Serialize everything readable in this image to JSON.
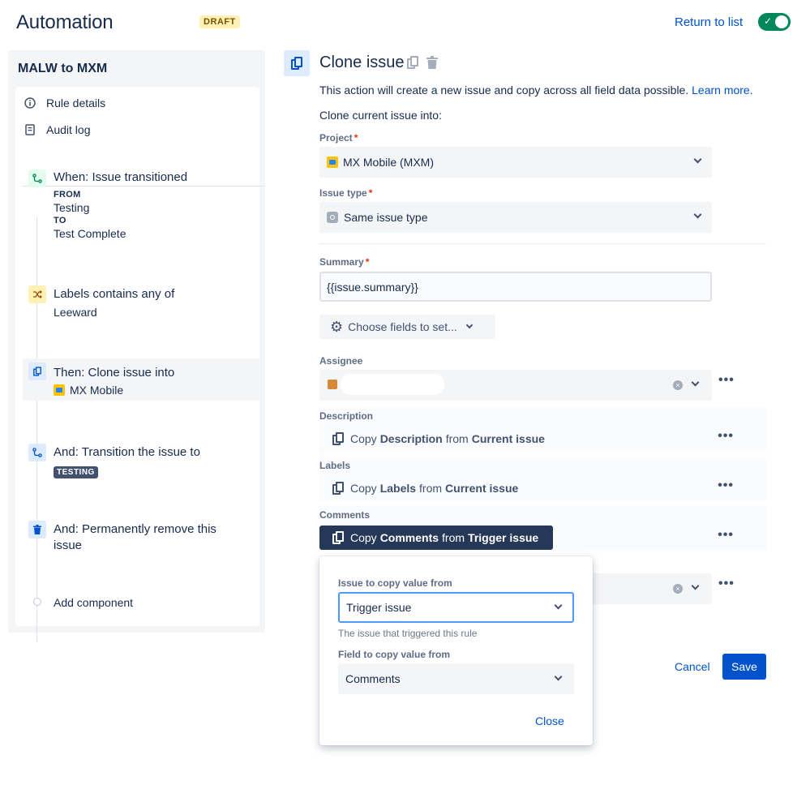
{
  "header": {
    "title": "Automation",
    "badge": "DRAFT",
    "return_link": "Return to list",
    "toggle_on": true
  },
  "sidebar": {
    "rule_name": "MALW to MXM",
    "nav": [
      {
        "label": "Rule details",
        "icon": "info-icon"
      },
      {
        "label": "Audit log",
        "icon": "document-icon"
      }
    ],
    "steps": [
      {
        "title": "When: Issue transitioned",
        "from_label": "FROM",
        "from": "Testing",
        "to_label": "TO",
        "to": "Test Complete",
        "icon": "transition-icon",
        "color": "#e3fcef"
      },
      {
        "title": "Labels contains any of",
        "sub": "Leeward",
        "icon": "shuffle-icon",
        "color": "#fff0b3"
      },
      {
        "title": "Then: Clone issue into",
        "sub": "MX Mobile",
        "icon": "copy-icon",
        "color": "#deebff"
      },
      {
        "title": "And: Transition the issue to",
        "lozenge": "TESTING",
        "icon": "transition-icon",
        "color": "#deebff"
      },
      {
        "title": "And: Permanently remove this issue",
        "icon": "trash-icon",
        "color": "#deebff"
      }
    ],
    "add_component": "Add component"
  },
  "main": {
    "title": "Clone issue",
    "description": "This action will create a new issue and copy across all field data possible.",
    "learn_more": "Learn more.",
    "clone_into": "Clone current issue into:",
    "project": {
      "label": "Project",
      "required": "*",
      "value": "MX Mobile (MXM)"
    },
    "issue_type": {
      "label": "Issue type",
      "required": "*",
      "value": "Same issue type"
    },
    "summary": {
      "label": "Summary",
      "required": "*",
      "value": "{{issue.summary}}"
    },
    "choose_fields": "Choose fields to set...",
    "assignee": {
      "label": "Assignee"
    },
    "copy_rows": [
      {
        "label": "Description",
        "copy": "Copy",
        "field": "Description",
        "from": "from",
        "source": "Current issue"
      },
      {
        "label": "Labels",
        "copy": "Copy",
        "field": "Labels",
        "from": "from",
        "source": "Current issue"
      },
      {
        "label": "Comments",
        "copy": "Copy",
        "field": "Comments",
        "from": "from",
        "source": "Trigger issue"
      }
    ],
    "popup": {
      "issue_label": "Issue to copy value from",
      "issue_value": "Trigger issue",
      "issue_helper": "The issue that triggered this rule",
      "field_label": "Field to copy value from",
      "field_value": "Comments",
      "close": "Close"
    },
    "cancel": "Cancel",
    "save": "Save"
  }
}
